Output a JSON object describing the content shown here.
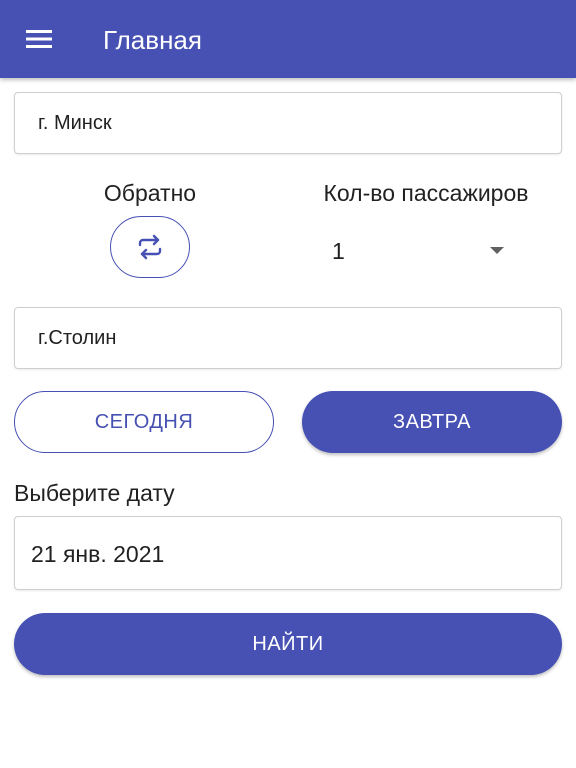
{
  "app_bar": {
    "menu_icon": "hamburger-menu-icon",
    "title": "Главная",
    "background": "#4651b3"
  },
  "origin": {
    "value": "г. Минск"
  },
  "swap": {
    "label": "Обратно",
    "icon": "swap-arrows-icon"
  },
  "passengers": {
    "label": "Кол-во пассажиров",
    "selected": "1",
    "icon": "dropdown-caret-icon"
  },
  "destination": {
    "value": "г.Столин"
  },
  "date_buttons": {
    "today_label": "СЕГОДНЯ",
    "tomorrow_label": "ЗАВТРА"
  },
  "date_picker": {
    "label": "Выберите дату",
    "value": "21 янв. 2021"
  },
  "search": {
    "label": "НАЙТИ"
  },
  "colors": {
    "accent": "#4651b3",
    "text": "#212121",
    "on_accent": "#ffffff"
  }
}
